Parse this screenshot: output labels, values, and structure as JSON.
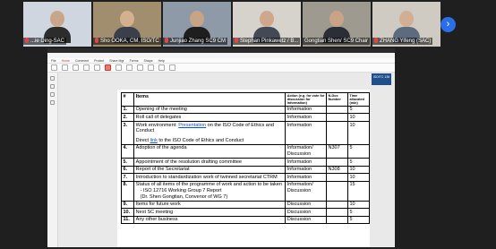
{
  "participants": [
    {
      "name": "...ie Ding-SAC",
      "bg": "#cfd6df",
      "skin": "#c9a68a",
      "shirt": "#2c2c2c",
      "muted": true
    },
    {
      "name": "Sho OOKA, CM, ISO/TC 135",
      "bg": "#a08e6e",
      "skin": "#d3b090",
      "shirt": "#3b3f4a",
      "muted": true
    },
    {
      "name": "Junjiao Zhang SC9 CM",
      "bg": "#8f9aa8",
      "skin": "#c7a486",
      "shirt": "#1e1e1e",
      "muted": true
    },
    {
      "name": "Stephan Pinkawetz / B...",
      "bg": "#d6d2cc",
      "skin": "#cfa78c",
      "shirt": "#444a55",
      "muted": true
    },
    {
      "name": "Gongtian Shen/ SC9 Chair",
      "bg": "#9e9a90",
      "skin": "#caa285",
      "shirt": "#2b2e36",
      "muted": false
    },
    {
      "name": "ZHANG Yifeng (SAC)",
      "bg": "#cfcac2",
      "skin": "#d2ae92",
      "shirt": "#5c6b7d",
      "muted": true
    }
  ],
  "screen": {
    "tabs": [
      "",
      "",
      "",
      ""
    ],
    "menu": [
      "File",
      "Home",
      "Comment",
      "Protect",
      "Share Mgr",
      "Forms",
      "Shape",
      "Help"
    ],
    "logo_text": "ISO/TC 135"
  },
  "table": {
    "headers": {
      "num": "#",
      "items": "Items",
      "action": "Action (e.g. for vote for discussion for information)",
      "ndoc": "N-Doc Number",
      "time": "Time allocated (min)"
    },
    "rows": [
      {
        "num": "1.",
        "item": "Opening of the meeting",
        "action": "Information",
        "ndoc": "",
        "time": "5"
      },
      {
        "num": "2.",
        "item": "Roll call of delegates",
        "action": "Information",
        "ndoc": "",
        "time": "10"
      },
      {
        "num": "3.",
        "item_pre": "Work environment: ",
        "item_link": "Presentation",
        "item_post": " on the ISO Code of Ethics and Conduct",
        "item2_pre": "Direct ",
        "item2_link": "link",
        "item2_post": " to the ISO Code of Ethics and Conduct",
        "action": "Information",
        "ndoc": "",
        "time": "10"
      },
      {
        "num": "4.",
        "item": "Adoption of the agenda",
        "action": "Information/ Discussion",
        "ndoc": "N307",
        "time": "5"
      },
      {
        "num": "5.",
        "item": "Appointment of the resolution drafting committee",
        "action": "Information",
        "ndoc": "",
        "time": "5"
      },
      {
        "num": "6.",
        "item": "Report of the Secretariat",
        "action": "Information",
        "ndoc": "N308",
        "time": "10"
      },
      {
        "num": "7.",
        "item": "Introduction to standardization work of twinned secretariat CTRM",
        "action": "Information",
        "ndoc": "",
        "time": "10"
      },
      {
        "num": "8.",
        "item": "Status of all items of the programme of work and action to be taken",
        "sub1": "ISO 12716 Working Group 7 Report",
        "sub2": "(Dr. Shen Gongtian, Convenor of WG 7)",
        "action": "Information/ Discussion",
        "ndoc": "",
        "time": "15"
      },
      {
        "num": "9.",
        "item": "Items for future work",
        "action": "Discussion",
        "ndoc": "",
        "time": "10"
      },
      {
        "num": "10.",
        "item": "Next SC meeting",
        "action": "Discussion",
        "ndoc": "",
        "time": "5"
      },
      {
        "num": "11.",
        "item": "Any other business",
        "action": "Discussion",
        "ndoc": "",
        "time": "5"
      }
    ]
  }
}
